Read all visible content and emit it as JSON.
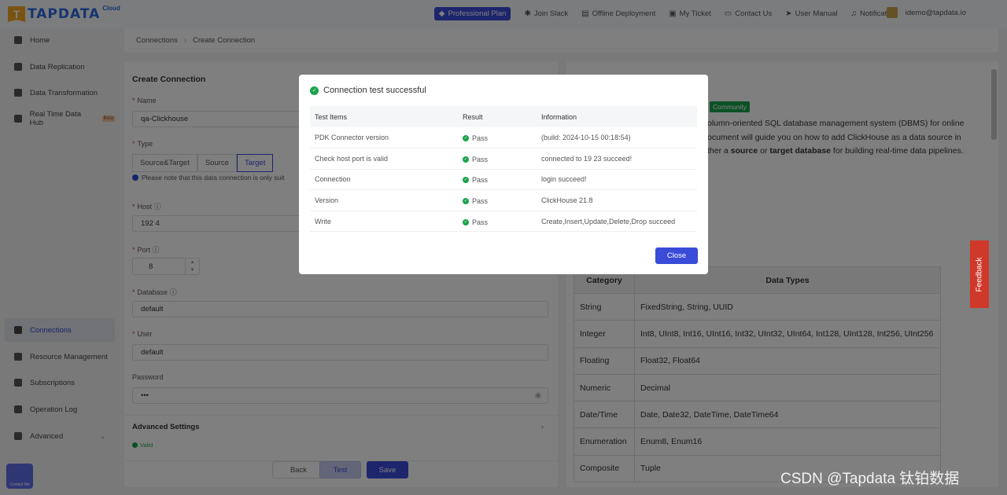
{
  "brand": {
    "logo_text": "TAPDATA",
    "cloud": "Cloud"
  },
  "topnav": {
    "plan": "Professional Plan",
    "join_slack": "Join Slack",
    "offline": "Offline Deployment",
    "ticket": "My Ticket",
    "contact": "Contact Us",
    "manual": "User Manual",
    "notification": "Notification",
    "user_email": "idemo@tapdata.io"
  },
  "sidebar": {
    "items": [
      {
        "label": "Home",
        "icon": "grid-icon"
      },
      {
        "label": "Data Replication",
        "icon": "copy-icon"
      },
      {
        "label": "Data Transformation",
        "icon": "flow-icon"
      },
      {
        "label": "Real Time Data Hub",
        "icon": "hub-icon",
        "badge": "Beta"
      },
      {
        "label": "Connections",
        "icon": "link-icon",
        "active": true
      },
      {
        "label": "Resource Management",
        "icon": "list-icon"
      },
      {
        "label": "Subscriptions",
        "icon": "bookmark-icon"
      },
      {
        "label": "Operation Log",
        "icon": "log-icon"
      },
      {
        "label": "Advanced",
        "icon": "diamond-icon"
      }
    ],
    "contact_me": "Contact Me"
  },
  "breadcrumb": {
    "root": "Connections",
    "current": "Create Connection"
  },
  "form": {
    "title": "Create Connection",
    "name_label": "Name",
    "name_value": "qa-Clickhouse",
    "type_label": "Type",
    "types": [
      "Source&Target",
      "Source",
      "Target"
    ],
    "type_selected": "Target",
    "type_note": "Please note that this data connection is only suit",
    "host_label": "Host",
    "host_value": "192            4",
    "port_label": "Port",
    "port_value": "8",
    "database_label": "Database",
    "database_value": "default",
    "user_label": "User",
    "user_value": "default",
    "password_label": "Password",
    "password_value": "•••",
    "advanced": "Advanced Settings",
    "valid": "Valid",
    "back": "Back",
    "test": "Test",
    "save": "Save"
  },
  "doc": {
    "badge": "Community",
    "line1": "olumn-oriented SQL database management system (DBMS) for online",
    "line2": "ocument will guide you on how to add ClickHouse as a data source in",
    "line3_pre": "ther a ",
    "line3_source": "source",
    "line3_mid": " or ",
    "line3_target": "target database",
    "line3_post": " for building real-time data pipelines.",
    "table_headers": [
      "Category",
      "Data Types"
    ],
    "table_rows": [
      [
        "String",
        "FixedString, String, UUID"
      ],
      [
        "Integer",
        "Int8, UInt8, Int16, UInt16, Int32, UInt32, UInt64, Int128, UInt128, Int256, UInt256"
      ],
      [
        "Floating",
        "Float32, Float64"
      ],
      [
        "Numeric",
        "Decimal"
      ],
      [
        "Date/Time",
        "Date, Date32, DateTime, DateTime64"
      ],
      [
        "Enumeration",
        "Enum8, Enum16"
      ],
      [
        "Composite",
        "Tuple"
      ]
    ],
    "feedback": "Feedback"
  },
  "modal": {
    "title": "Connection test successful",
    "headers": [
      "Test Items",
      "Result",
      "Information"
    ],
    "rows": [
      {
        "item": "PDK Connector version",
        "result": "Pass",
        "info": "(build: 2024-10-15 00:18:54)"
      },
      {
        "item": "Check host port is valid",
        "result": "Pass",
        "info": "connected to 19               23 succeed!"
      },
      {
        "item": "Connection",
        "result": "Pass",
        "info": "login succeed!"
      },
      {
        "item": "Version",
        "result": "Pass",
        "info": "ClickHouse 21.8"
      },
      {
        "item": "Write",
        "result": "Pass",
        "info": "Create,Insert,Update,Delete,Drop succeed"
      }
    ],
    "close": "Close"
  },
  "watermark": "CSDN @Tapdata 钛铂数据"
}
